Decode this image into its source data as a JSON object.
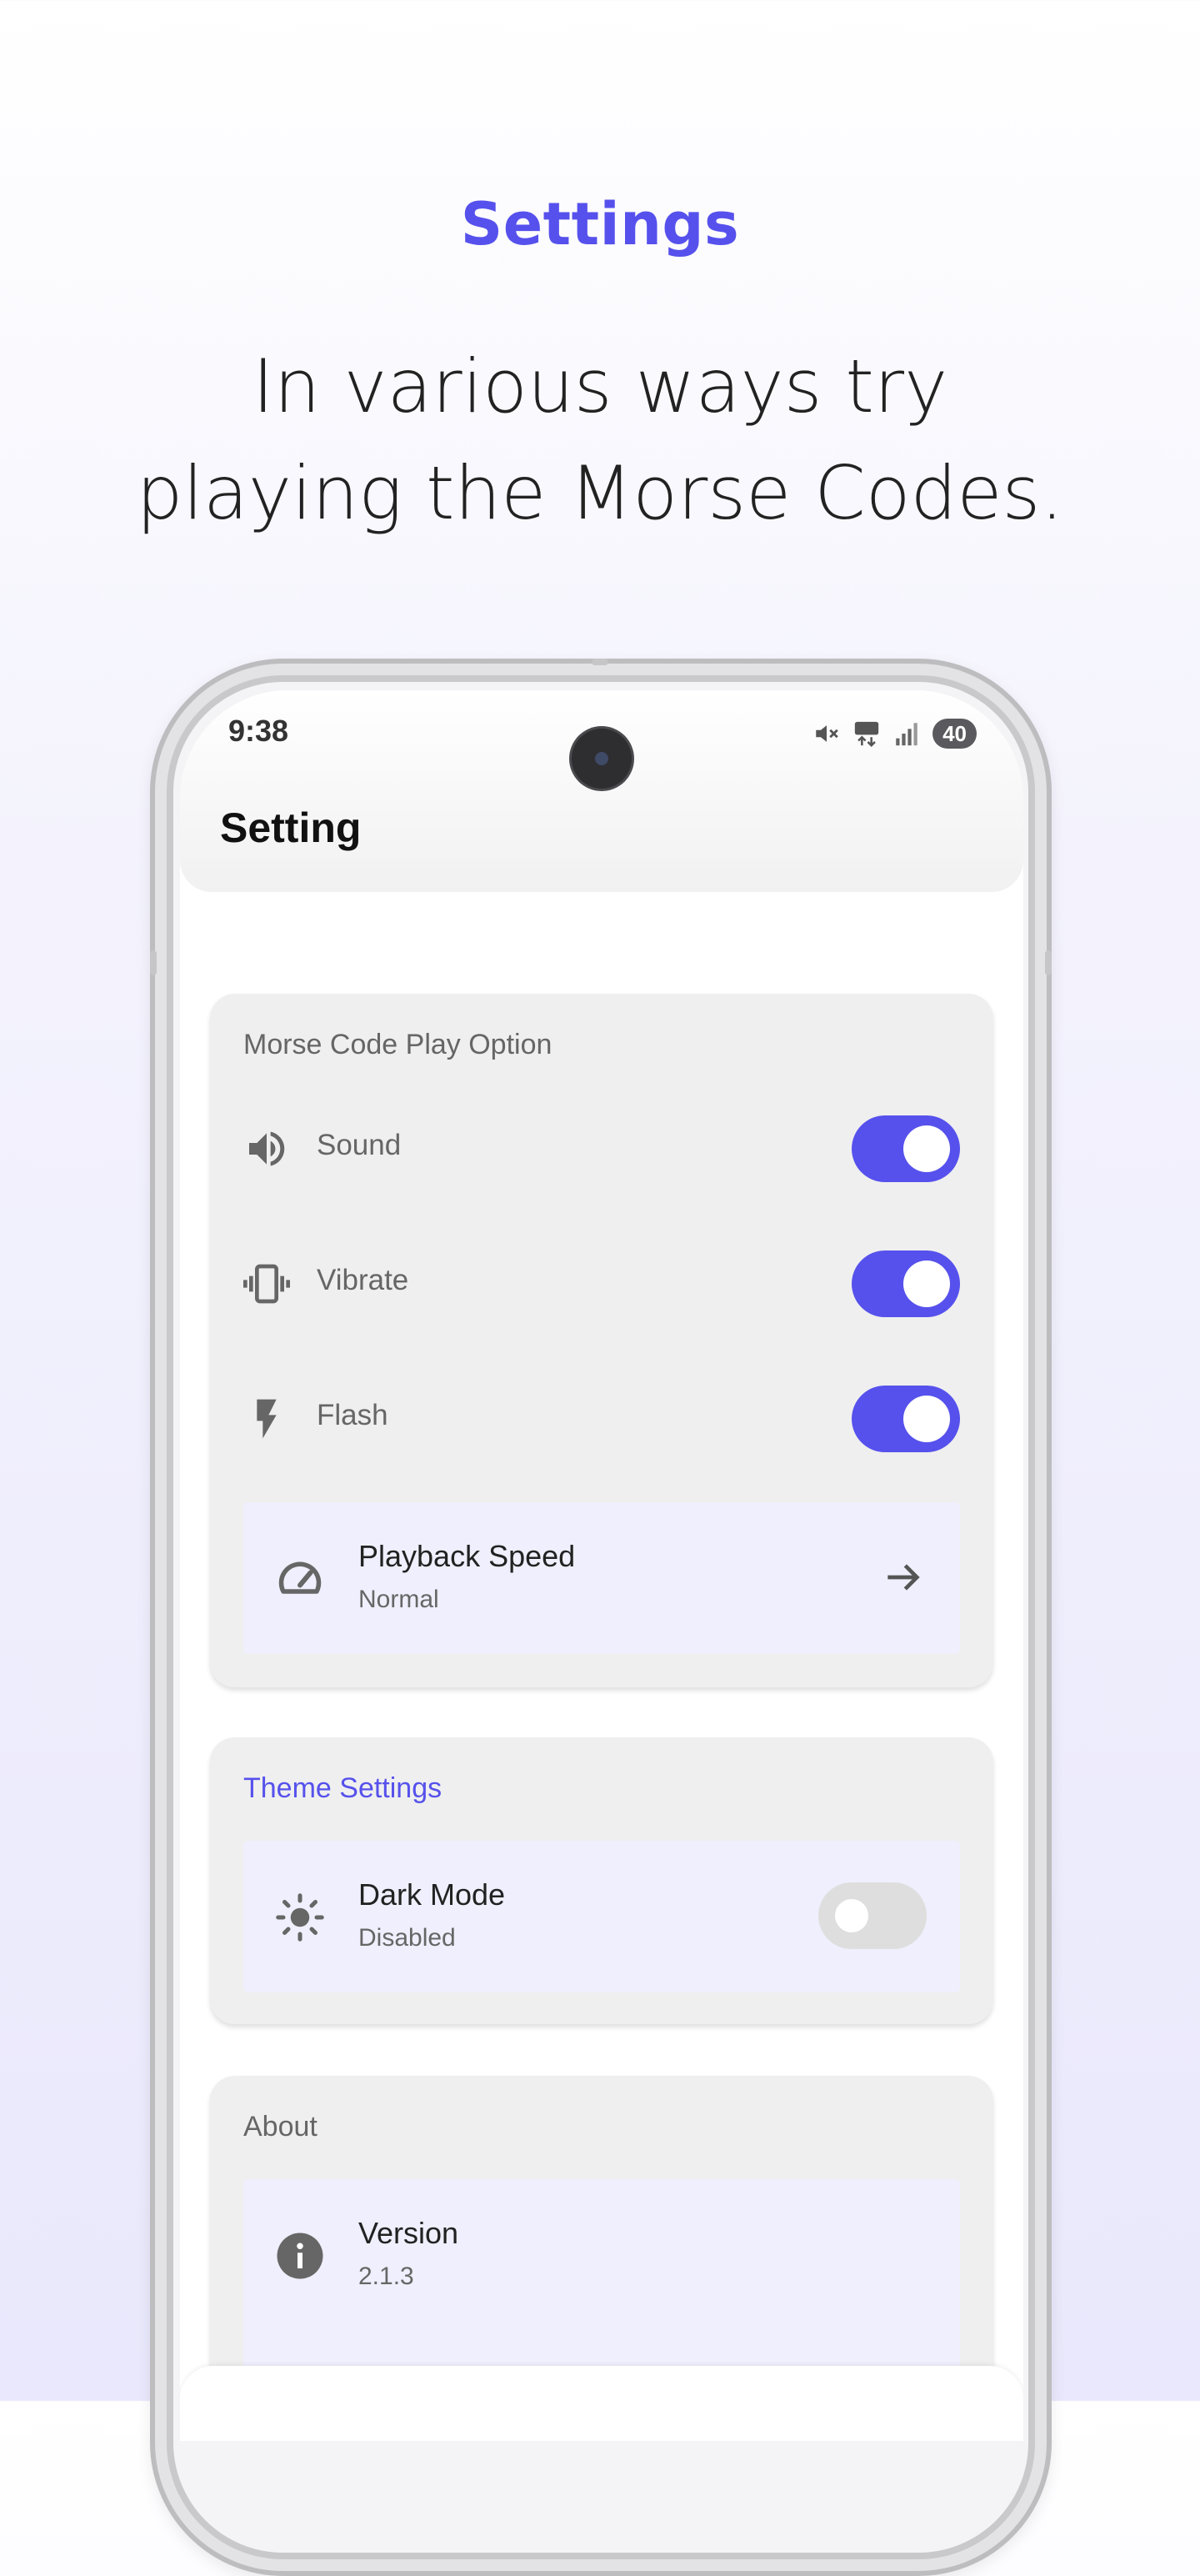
{
  "hero": {
    "title": "Settings",
    "subtitle_line1": "In various ways try",
    "subtitle_line2": "playing the Morse Codes."
  },
  "status_bar": {
    "time": "9:38",
    "battery": "40",
    "icons": [
      "mute-icon",
      "5g-icon",
      "signal-icon",
      "battery-icon"
    ]
  },
  "app": {
    "title": "Setting"
  },
  "play_option": {
    "title": "Morse Code Play Option",
    "items": [
      {
        "label": "Sound",
        "icon": "speaker-icon",
        "enabled": true
      },
      {
        "label": "Vibrate",
        "icon": "vibrate-icon",
        "enabled": true
      },
      {
        "label": "Flash",
        "icon": "flash-icon",
        "enabled": true
      }
    ],
    "speed": {
      "title": "Playback Speed",
      "value": "Normal",
      "icon": "speedometer-icon"
    }
  },
  "theme": {
    "title": "Theme Settings",
    "dark_mode": {
      "title": "Dark Mode",
      "value": "Disabled",
      "enabled": false,
      "icon": "sun-icon"
    }
  },
  "about": {
    "title": "About",
    "version": {
      "title": "Version",
      "value": "2.1.3",
      "icon": "info-icon"
    }
  },
  "colors": {
    "accent": "#5651ec",
    "card_bg": "#efefef",
    "tile_bg": "#efeffd",
    "toggle_off": "#dedede"
  }
}
